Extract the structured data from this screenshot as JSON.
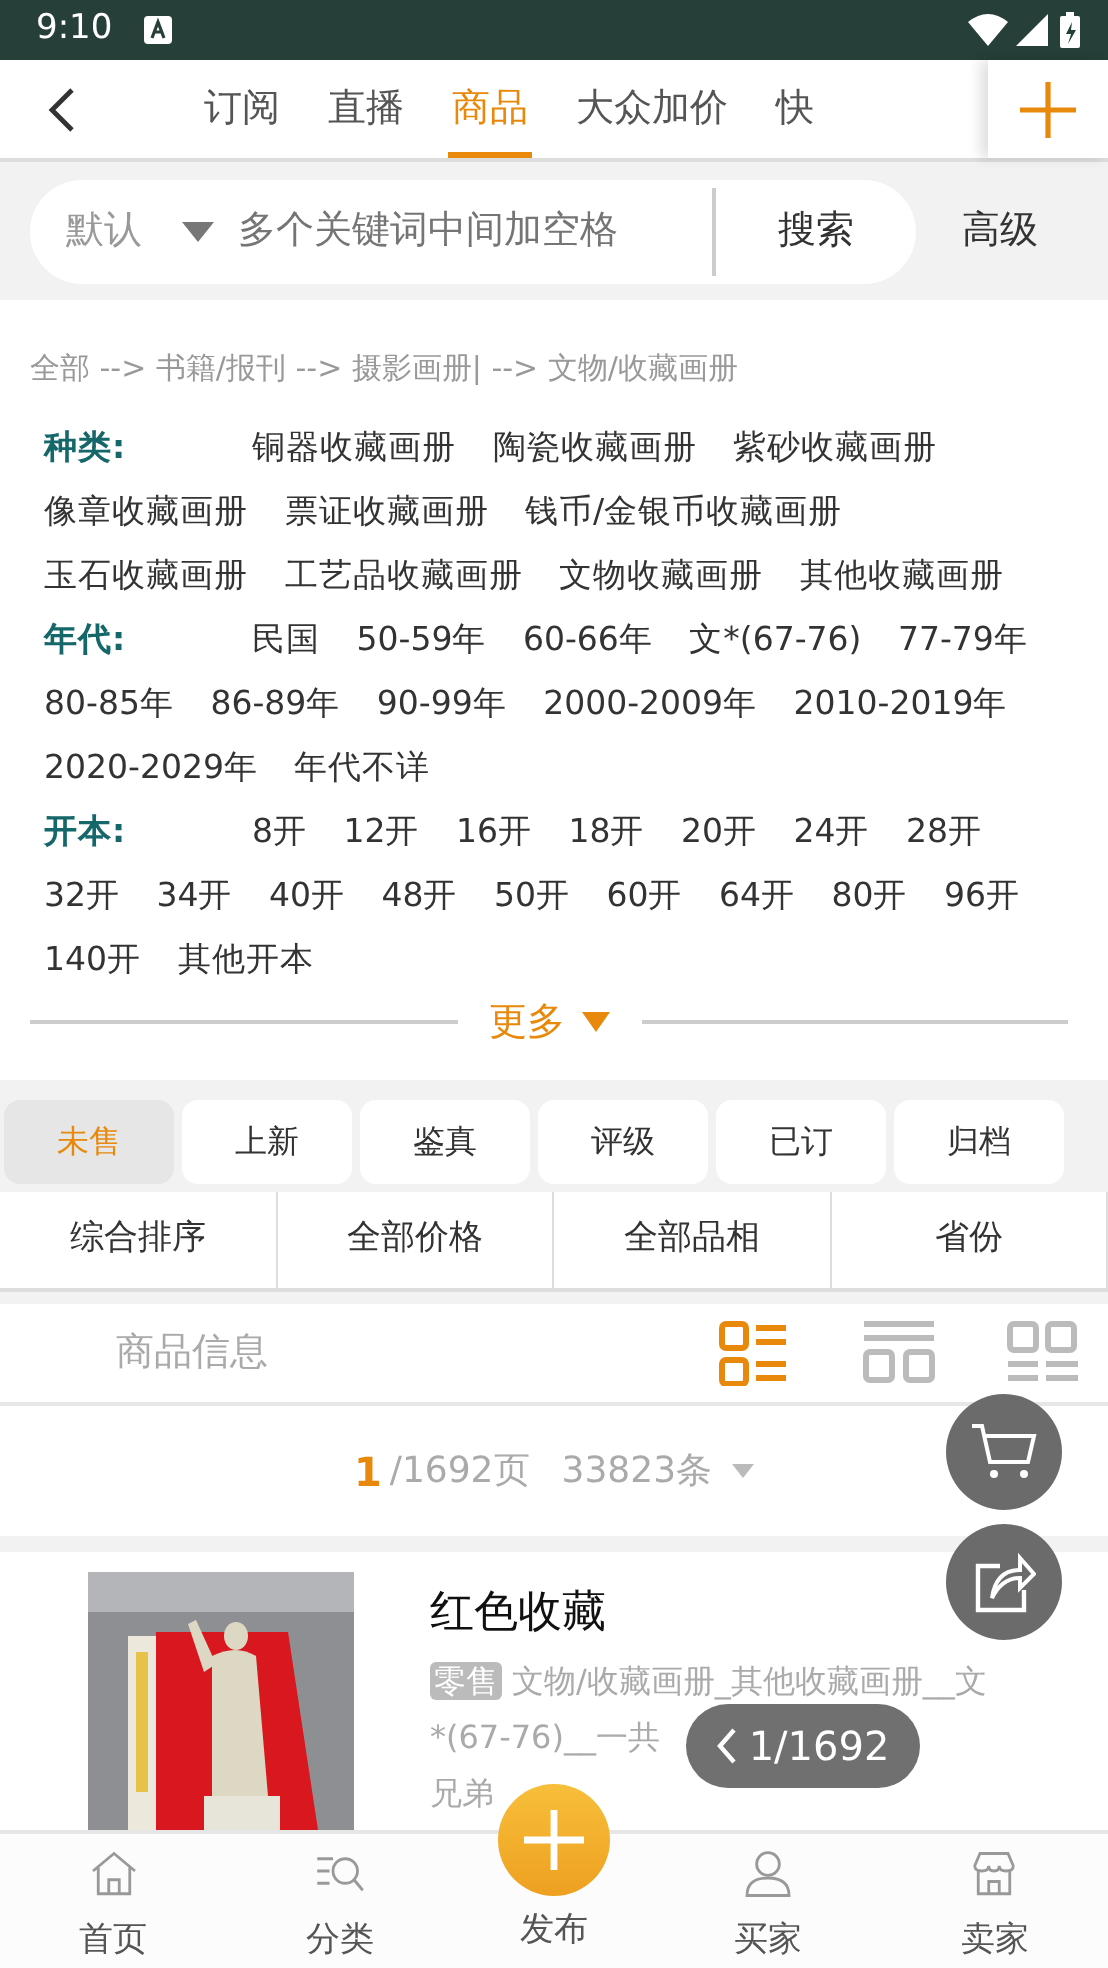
{
  "status_bar": {
    "time": "9:10"
  },
  "top_tabs": [
    {
      "label": "订阅",
      "selected": false
    },
    {
      "label": "直播",
      "selected": false
    },
    {
      "label": "商品",
      "selected": true
    },
    {
      "label": "大众加价",
      "selected": false
    },
    {
      "label": "快",
      "selected": false
    }
  ],
  "search": {
    "scope": "默认",
    "placeholder": "多个关键词中间加空格",
    "button": "搜索",
    "advanced": "高级"
  },
  "breadcrumb": "全部 --> 书籍/报刊 --> 摄影画册| --> 文物/收藏画册",
  "filters": [
    {
      "label": "种类:",
      "options": [
        "铜器收藏画册",
        "陶瓷收藏画册",
        "紫砂收藏画册",
        "像章收藏画册",
        "票证收藏画册",
        "钱币/金银币收藏画册",
        "玉石收藏画册",
        "工艺品收藏画册",
        "文物收藏画册",
        "其他收藏画册"
      ]
    },
    {
      "label": "年代:",
      "options": [
        "民国",
        "50-59年",
        "60-66年",
        "文*(67-76)",
        "77-79年",
        "80-85年",
        "86-89年",
        "90-99年",
        "2000-2009年",
        "2010-2019年",
        "2020-2029年",
        "年代不详"
      ]
    },
    {
      "label": "开本:",
      "options": [
        "8开",
        "12开",
        "16开",
        "18开",
        "20开",
        "24开",
        "28开",
        "32开",
        "34开",
        "40开",
        "48开",
        "50开",
        "60开",
        "64开",
        "80开",
        "96开",
        "140开",
        "其他开本"
      ]
    }
  ],
  "more": "更多",
  "status_chips": [
    {
      "label": "未售",
      "selected": true
    },
    {
      "label": "上新",
      "selected": false
    },
    {
      "label": "鉴真",
      "selected": false
    },
    {
      "label": "评级",
      "selected": false
    },
    {
      "label": "已订",
      "selected": false
    },
    {
      "label": "归档",
      "selected": false
    }
  ],
  "sort_options": [
    "综合排序",
    "全部价格",
    "全部品相",
    "省份"
  ],
  "list_header": {
    "label": "商品信息",
    "view_modes": [
      {
        "kind": "list",
        "selected": true
      },
      {
        "kind": "rows",
        "selected": false
      },
      {
        "kind": "grid",
        "selected": false
      }
    ]
  },
  "pagination": {
    "page": "1",
    "pages": "/1692页",
    "count": "33823条"
  },
  "products": [
    {
      "image": {
        "kind": "picture"
      },
      "title": "红色收藏",
      "tag": "零售",
      "description_lines": [
        "文物/收藏画册_其他收藏画册__文",
        "*(67-76)__一共"
      ],
      "shop": "兄弟"
    }
  ],
  "page_indicator": "1/1692",
  "bottom_nav": [
    {
      "label": "首页",
      "kind": "home"
    },
    {
      "label": "分类",
      "kind": "category"
    },
    {
      "label": "发布",
      "kind": "publish"
    },
    {
      "label": "买家",
      "kind": "buyer"
    },
    {
      "label": "卖家",
      "kind": "seller"
    }
  ]
}
